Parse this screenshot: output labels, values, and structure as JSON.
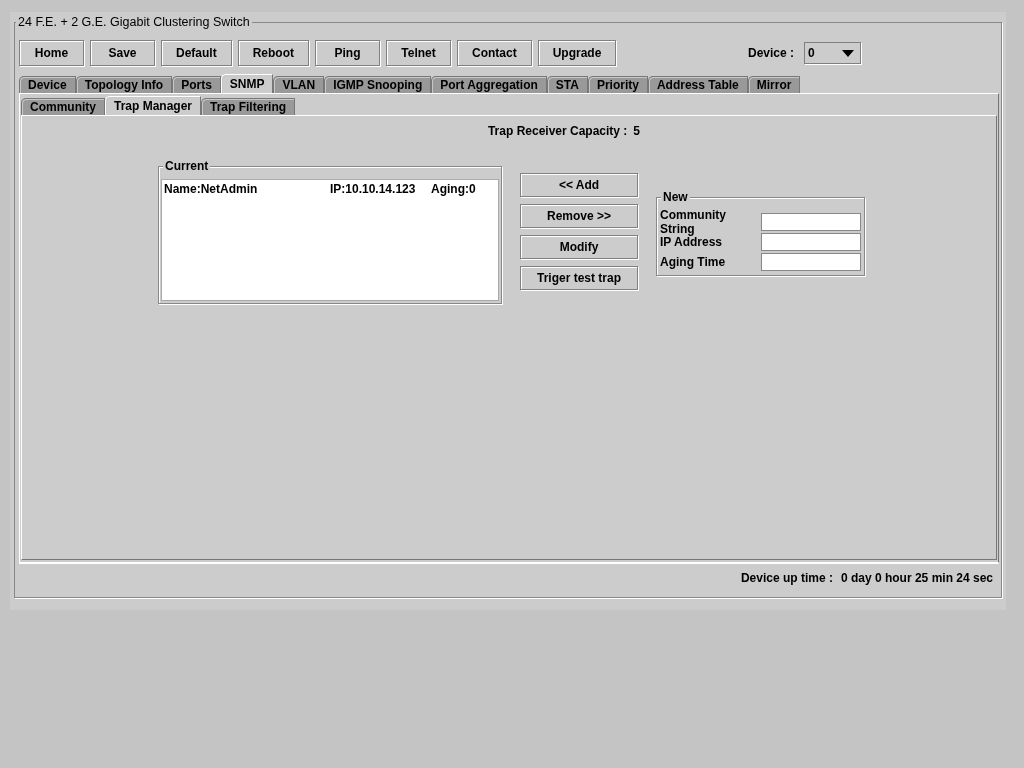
{
  "window": {
    "title": "24 F.E. + 2 G.E. Gigabit Clustering Switch"
  },
  "toolbar": [
    "Home",
    "Save",
    "Default",
    "Reboot",
    "Ping",
    "Telnet",
    "Contact",
    "Upgrade"
  ],
  "device": {
    "label": "Device :",
    "value": "0"
  },
  "tabs": [
    {
      "label": "Device",
      "selected": false
    },
    {
      "label": "Topology Info",
      "selected": false
    },
    {
      "label": "Ports",
      "selected": false
    },
    {
      "label": "SNMP",
      "selected": true
    },
    {
      "label": "VLAN",
      "selected": false
    },
    {
      "label": "IGMP Snooping",
      "selected": false
    },
    {
      "label": "Port Aggregation",
      "selected": false
    },
    {
      "label": "STA",
      "selected": false
    },
    {
      "label": "Priority",
      "selected": false
    },
    {
      "label": "Address Table",
      "selected": false
    },
    {
      "label": "Mirror",
      "selected": false
    }
  ],
  "subtabs": [
    {
      "label": "Community",
      "selected": false
    },
    {
      "label": "Trap Manager",
      "selected": true
    },
    {
      "label": "Trap Filtering",
      "selected": false
    }
  ],
  "capacity": {
    "label": "Trap Receiver Capacity :",
    "value": "5"
  },
  "current": {
    "title": "Current",
    "entries": [
      {
        "name": "Name:NetAdmin",
        "ip": "IP:10.10.14.123",
        "aging": "Aging:0"
      }
    ]
  },
  "actions": [
    "<< Add",
    "Remove >>",
    "Modify",
    "Triger test trap"
  ],
  "new": {
    "title": "New",
    "fields": [
      {
        "label": "Community String"
      },
      {
        "label": "IP Address"
      },
      {
        "label": "Aging Time"
      }
    ]
  },
  "status_bar": {
    "label": "Device up time :",
    "value": "0 day 0 hour 25 min 24 sec"
  }
}
